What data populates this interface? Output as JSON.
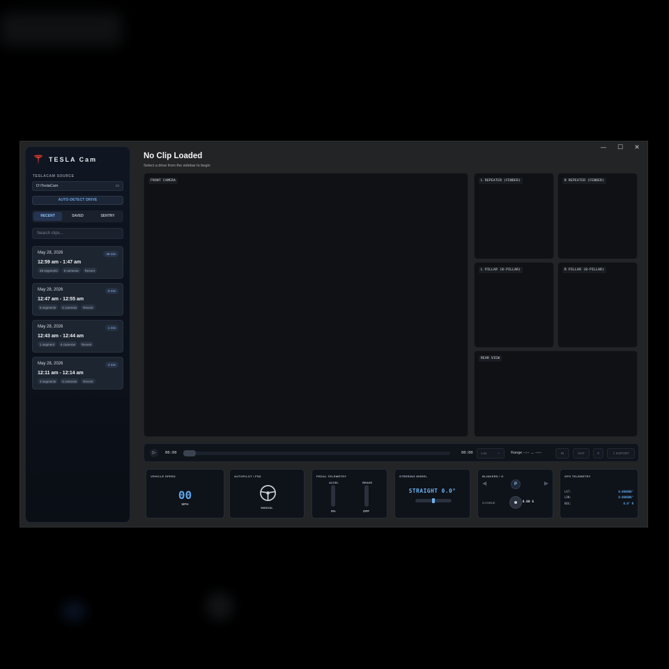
{
  "colors": {
    "accent": "#5aa7ec",
    "brand_red": "#e23b30",
    "panel_bg": "#0e1219",
    "window_bg": "#232425"
  },
  "window_controls": {
    "minimize": "—",
    "maximize": "☐",
    "close": "✕"
  },
  "sidebar": {
    "brand": "TESLA Cam",
    "source_label": "TESLACAM SOURCE",
    "source_path": "D:\\TeslaCam",
    "autodetect_label": "AUTO-DETECT DRIVE",
    "tabs": [
      {
        "label": "RECENT",
        "active": true
      },
      {
        "label": "SAVED",
        "active": false
      },
      {
        "label": "SENTRY",
        "active": false
      }
    ],
    "search_placeholder": "Search clips...",
    "clips": [
      {
        "date": "May 28, 2026",
        "duration": "48 min",
        "time": "12:59 am - 1:47 am",
        "tags": [
          "48 segments",
          "6 cameras",
          "Recent"
        ]
      },
      {
        "date": "May 28, 2026",
        "duration": "8 min",
        "time": "12:47 am - 12:55 am",
        "tags": [
          "8 segments",
          "6 cameras",
          "Recent"
        ]
      },
      {
        "date": "May 28, 2026",
        "duration": "1 min",
        "time": "12:43 am - 12:44 am",
        "tags": [
          "1 segment",
          "6 cameras",
          "Recent"
        ]
      },
      {
        "date": "May 28, 2026",
        "duration": "3 min",
        "time": "12:11 am - 12:14 am",
        "tags": [
          "3 segments",
          "6 cameras",
          "Recent"
        ]
      }
    ]
  },
  "header": {
    "title": "No Clip Loaded",
    "subtitle": "Select a drive from the sidebar to begin"
  },
  "cameras": {
    "front": "FRONT CAMERA",
    "l_repeater": "L REPEATER (FENDER)",
    "r_repeater": "R REPEATER (FENDER)",
    "l_pillar": "L PILLAR (B-PILLAR)",
    "r_pillar": "R PILLAR (B-PILLAR)",
    "rear": "REAR VIEW"
  },
  "playback": {
    "play_icon": "▷",
    "time_start": "00:00",
    "time_end": "00:00",
    "progress": 0,
    "speed": "1.0x",
    "range_label": "Range --:-- → --:--",
    "in_label": "IN",
    "out_label": "OUT",
    "clear_icon": "✕",
    "export_label": "⇩ EXPORT"
  },
  "telemetry": {
    "speed": {
      "title": "VEHICLE SPEED",
      "value": "00",
      "unit": "MPH"
    },
    "autopilot": {
      "title": "AUTOPILOT / FSD",
      "status": "MANUAL"
    },
    "pedals": {
      "title": "PEDAL TELEMETRY",
      "accel_label": "ACCEL",
      "brake_label": "BRAKE",
      "accel_value": "0%",
      "brake_value": "OFF"
    },
    "steering": {
      "title": "STEERING WHEEL",
      "value": "STRAIGHT 0.0°"
    },
    "blinkers": {
      "title": "BLINKERS / G",
      "left_arrow": "◀",
      "right_arrow": "▶",
      "gear": "P",
      "g_label": "G-FORCE",
      "g_value": "0.00 G"
    },
    "gps": {
      "title": "GPS TELEMETRY",
      "lat_label": "LAT:",
      "lat_value": "0.000000°",
      "lon_label": "LON:",
      "lon_value": "0.000000°",
      "hdg_label": "HDG:",
      "hdg_value": "0.0° N"
    }
  }
}
